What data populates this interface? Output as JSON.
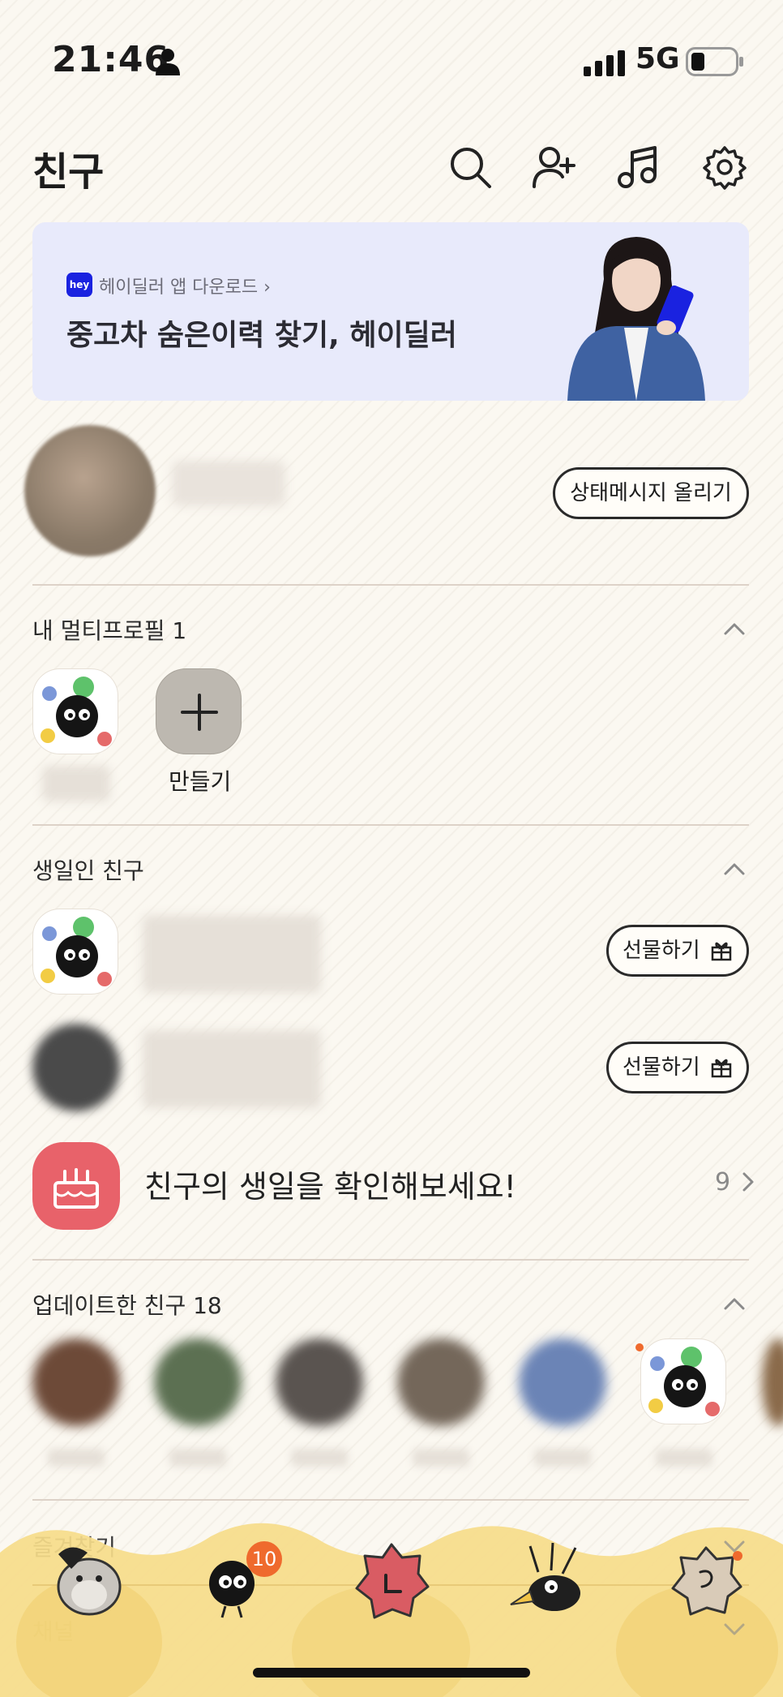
{
  "status_bar": {
    "time": "21:46",
    "network": "5G"
  },
  "header": {
    "title": "친구",
    "icons": [
      "search-icon",
      "add-friend-icon",
      "music-icon",
      "settings-icon"
    ]
  },
  "banner": {
    "badge": "hey",
    "subtitle": "헤이딜러 앱 다운로드 ›",
    "title": "중고차 숨은이력 찾기, 헤이딜러"
  },
  "profile": {
    "status_button": "상태메시지 올리기"
  },
  "multi_profile": {
    "title": "내 멀티프로필 1",
    "make_label": "만들기"
  },
  "birthday": {
    "title": "생일인 친구",
    "gift_label": "선물하기",
    "cta": "친구의 생일을 확인해보세요!",
    "count": "9"
  },
  "updated": {
    "title": "업데이트한 친구 18"
  },
  "favorites": {
    "title": "즐겨찾기"
  },
  "channel": {
    "title": "채널"
  },
  "tabbar": {
    "badge": "10"
  },
  "colors": {
    "accent_badge": "#ef6a2d",
    "bday_icon": "#e8626a",
    "banner_bg": "#e8eafb",
    "tabbar": "#f6dc8a"
  }
}
